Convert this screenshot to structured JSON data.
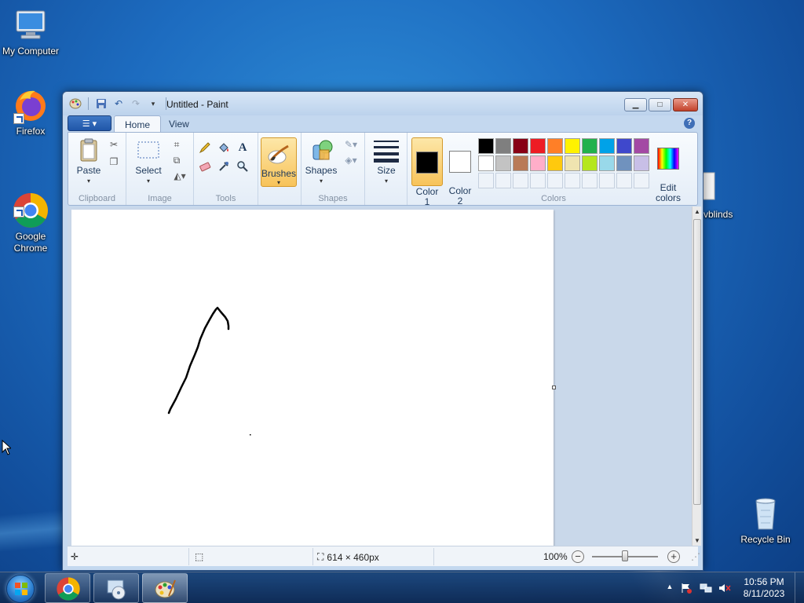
{
  "desktop": {
    "icons": [
      {
        "label": "My Computer"
      },
      {
        "label": "Firefox"
      },
      {
        "label": "Google\nChrome"
      },
      {
        "label": "vblinds"
      },
      {
        "label": "Recycle Bin"
      }
    ]
  },
  "window": {
    "title": "Untitled - Paint",
    "tabs": [
      {
        "label": "Home"
      },
      {
        "label": "View"
      }
    ],
    "active_tab": "Home"
  },
  "ribbon": {
    "groups": {
      "clipboard": "Clipboard",
      "image": "Image",
      "tools": "Tools",
      "shapes": "Shapes",
      "colors": "Colors"
    },
    "paste_label": "Paste",
    "select_label": "Select",
    "brushes_label": "Brushes",
    "shapes_label": "Shapes",
    "size_label": "Size",
    "color1_label": "Color\n1",
    "color2_label": "Color\n2",
    "edit_colors_label": "Edit\ncolors",
    "color1_value": "#000000",
    "color2_value": "#ffffff",
    "palette_row1": [
      "#000000",
      "#7f7f7f",
      "#880015",
      "#ed1c24",
      "#ff7f27",
      "#fff200",
      "#22b14c",
      "#00a2e8",
      "#3f48cc",
      "#a349a4"
    ],
    "palette_row2": [
      "#ffffff",
      "#c3c3c3",
      "#b97a57",
      "#ffaec9",
      "#ffc90e",
      "#efe4b0",
      "#b5e61d",
      "#99d9ea",
      "#7092be",
      "#c8bfe7"
    ]
  },
  "statusbar": {
    "canvas_size": "614 × 460px",
    "zoom": "100%"
  },
  "taskbar": {
    "time": "10:56 PM",
    "date": "8/11/2023"
  }
}
